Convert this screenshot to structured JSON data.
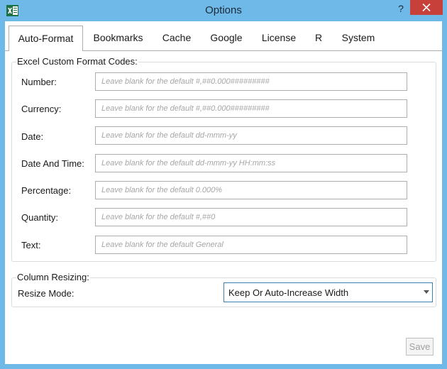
{
  "window": {
    "title": "Options",
    "help_glyph": "?"
  },
  "tabs": [
    {
      "label": "Auto-Format",
      "active": true
    },
    {
      "label": "Bookmarks",
      "active": false
    },
    {
      "label": "Cache",
      "active": false
    },
    {
      "label": "Google",
      "active": false
    },
    {
      "label": "License",
      "active": false
    },
    {
      "label": "R",
      "active": false
    },
    {
      "label": "System",
      "active": false
    }
  ],
  "format_codes": {
    "group_label": "Excel Custom Format Codes:",
    "fields": [
      {
        "label": "Number:",
        "value": "",
        "placeholder": "Leave blank for the default #,##0.000#########"
      },
      {
        "label": "Currency:",
        "value": "",
        "placeholder": "Leave blank for the default #,##0.000#########"
      },
      {
        "label": "Date:",
        "value": "",
        "placeholder": "Leave blank for the default dd-mmm-yy"
      },
      {
        "label": "Date And Time:",
        "value": "",
        "placeholder": "Leave blank for the default dd-mmm-yy HH:mm:ss"
      },
      {
        "label": "Percentage:",
        "value": "",
        "placeholder": "Leave blank for the default 0.000%"
      },
      {
        "label": "Quantity:",
        "value": "",
        "placeholder": "Leave blank for the default #,##0"
      },
      {
        "label": "Text:",
        "value": "",
        "placeholder": "Leave blank for the default General"
      }
    ]
  },
  "column_resizing": {
    "group_label": "Column Resizing:",
    "mode_label": "Resize Mode:",
    "mode_value": "Keep Or Auto-Increase Width"
  },
  "footer": {
    "save_label": "Save"
  },
  "colors": {
    "titlebar": "#6fb9e8",
    "close_button": "#c7413a",
    "excel_green": "#1e7145"
  },
  "icons": {
    "app": "excel-icon",
    "close": "close-icon",
    "dropdown": "chevron-down-icon"
  }
}
